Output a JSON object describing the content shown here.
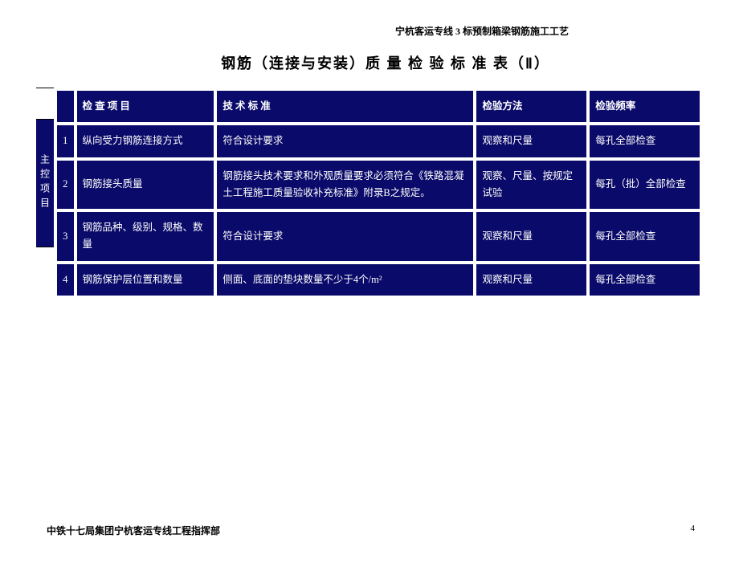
{
  "header_right": "宁杭客运专线 3 标预制箱梁钢筋施工工艺",
  "title": "钢筋（连接与安装）质 量 检 验 标 准 表（Ⅱ）",
  "side_label": "主控项目",
  "columns": {
    "c1": "检 查 项 目",
    "c2": "技 术 标 准",
    "c3": "检验方法",
    "c4": "检验频率"
  },
  "rows": [
    {
      "idx": "1",
      "item": "纵向受力钢筋连接方式",
      "std": "符合设计要求",
      "method": "观察和尺量",
      "freq": "每孔全部检查"
    },
    {
      "idx": "2",
      "item": "钢筋接头质量",
      "std": "钢筋接头技术要求和外观质量要求必须符合《铁路混凝土工程施工质量验收补充标准》附录B之规定。",
      "method": "观察、尺量、按规定试验",
      "freq": "每孔（批）全部检查"
    },
    {
      "idx": "3",
      "item": "钢筋品种、级别、规格、数量",
      "std": "符合设计要求",
      "method": "观察和尺量",
      "freq": "每孔全部检查"
    },
    {
      "idx": "4",
      "item": "钢筋保护层位置和数量",
      "std": "侧面、底面的垫块数量不少于4个/m²",
      "method": "观察和尺量",
      "freq": "每孔全部检查"
    }
  ],
  "footer_left": "中铁十七局集团宁杭客运专线工程指挥部",
  "page_num": "4"
}
